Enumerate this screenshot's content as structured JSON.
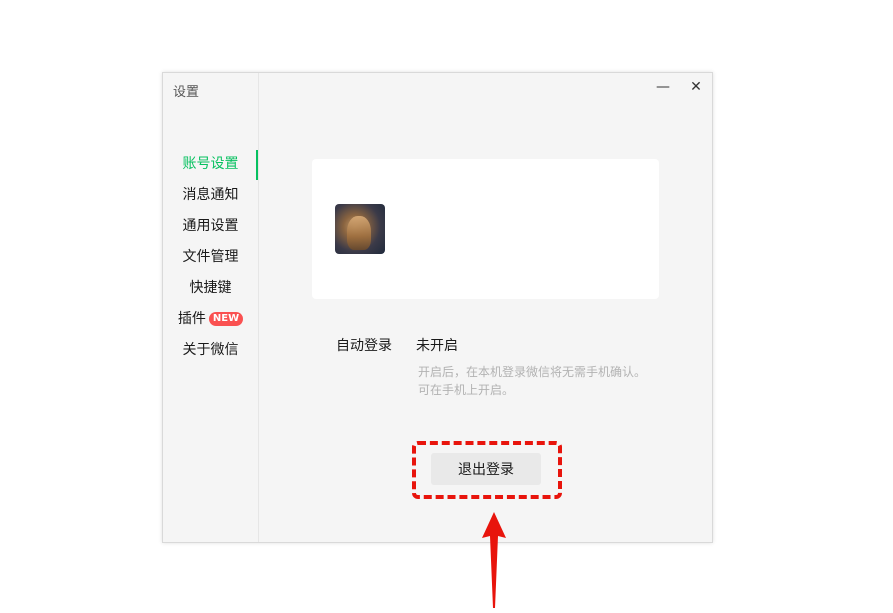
{
  "window": {
    "title": "设置",
    "minimize_glyph": "—",
    "close_glyph": "✕"
  },
  "nav": {
    "items": [
      {
        "label": "账号设置",
        "active": true
      },
      {
        "label": "消息通知"
      },
      {
        "label": "通用设置"
      },
      {
        "label": "文件管理"
      },
      {
        "label": "快捷键"
      },
      {
        "label": "插件",
        "badge": "NEW"
      },
      {
        "label": "关于微信"
      }
    ]
  },
  "account": {
    "avatar_icon": "user-avatar",
    "auto_login": {
      "label": "自动登录",
      "value": "未开启",
      "hint_line1": "开启后，在本机登录微信将无需手机确认。",
      "hint_line2": "可在手机上开启。"
    },
    "logout_label": "退出登录"
  },
  "colors": {
    "accent": "#07c160",
    "badge": "#fa5151",
    "annotation": "#e8140c"
  }
}
